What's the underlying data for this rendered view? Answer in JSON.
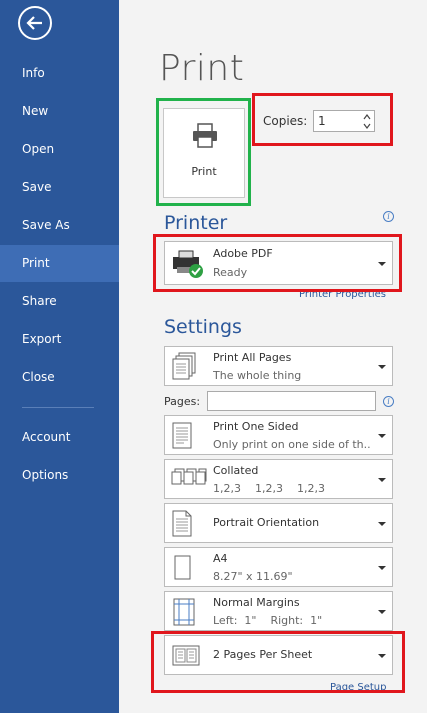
{
  "sidebar": {
    "items": [
      {
        "label": "Info"
      },
      {
        "label": "New"
      },
      {
        "label": "Open"
      },
      {
        "label": "Save"
      },
      {
        "label": "Save As"
      },
      {
        "label": "Print"
      },
      {
        "label": "Share"
      },
      {
        "label": "Export"
      },
      {
        "label": "Close"
      },
      {
        "label": "Account"
      },
      {
        "label": "Options"
      }
    ],
    "active": "Print"
  },
  "main": {
    "title": "Print",
    "print_button_label": "Print",
    "copies_label": "Copies:",
    "copies_value": "1",
    "printer_section": "Printer",
    "printer_name": "Adobe PDF",
    "printer_status": "Ready",
    "printer_properties_link": "Printer Properties",
    "settings_section": "Settings",
    "pages_label": "Pages:",
    "settings": [
      {
        "line1": "Print All Pages",
        "line2": "The whole thing",
        "icon": "pages-icon"
      },
      {
        "line1": "Print One Sided",
        "line2": "Only print on one side of th...",
        "icon": "one-sided-icon"
      },
      {
        "line1": "Collated",
        "line2": "1,2,3    1,2,3    1,2,3",
        "icon": "collated-icon"
      },
      {
        "line1": "Portrait Orientation",
        "line2": "",
        "icon": "portrait-icon"
      },
      {
        "line1": "A4",
        "line2": "8.27\" x 11.69\"",
        "icon": "paper-size-icon"
      },
      {
        "line1": "Normal Margins",
        "line2": "Left:  1\"    Right:  1\"",
        "icon": "margins-icon"
      },
      {
        "line1": "2 Pages Per Sheet",
        "line2": "",
        "icon": "pages-per-sheet-icon"
      }
    ],
    "page_setup_link": "Page Setup"
  },
  "colors": {
    "sidebar": "#2b579a",
    "sidebar_active": "#3e6db5",
    "accent": "#2b579a",
    "highlight_red": "#e0161c",
    "highlight_green": "#21b24b"
  }
}
